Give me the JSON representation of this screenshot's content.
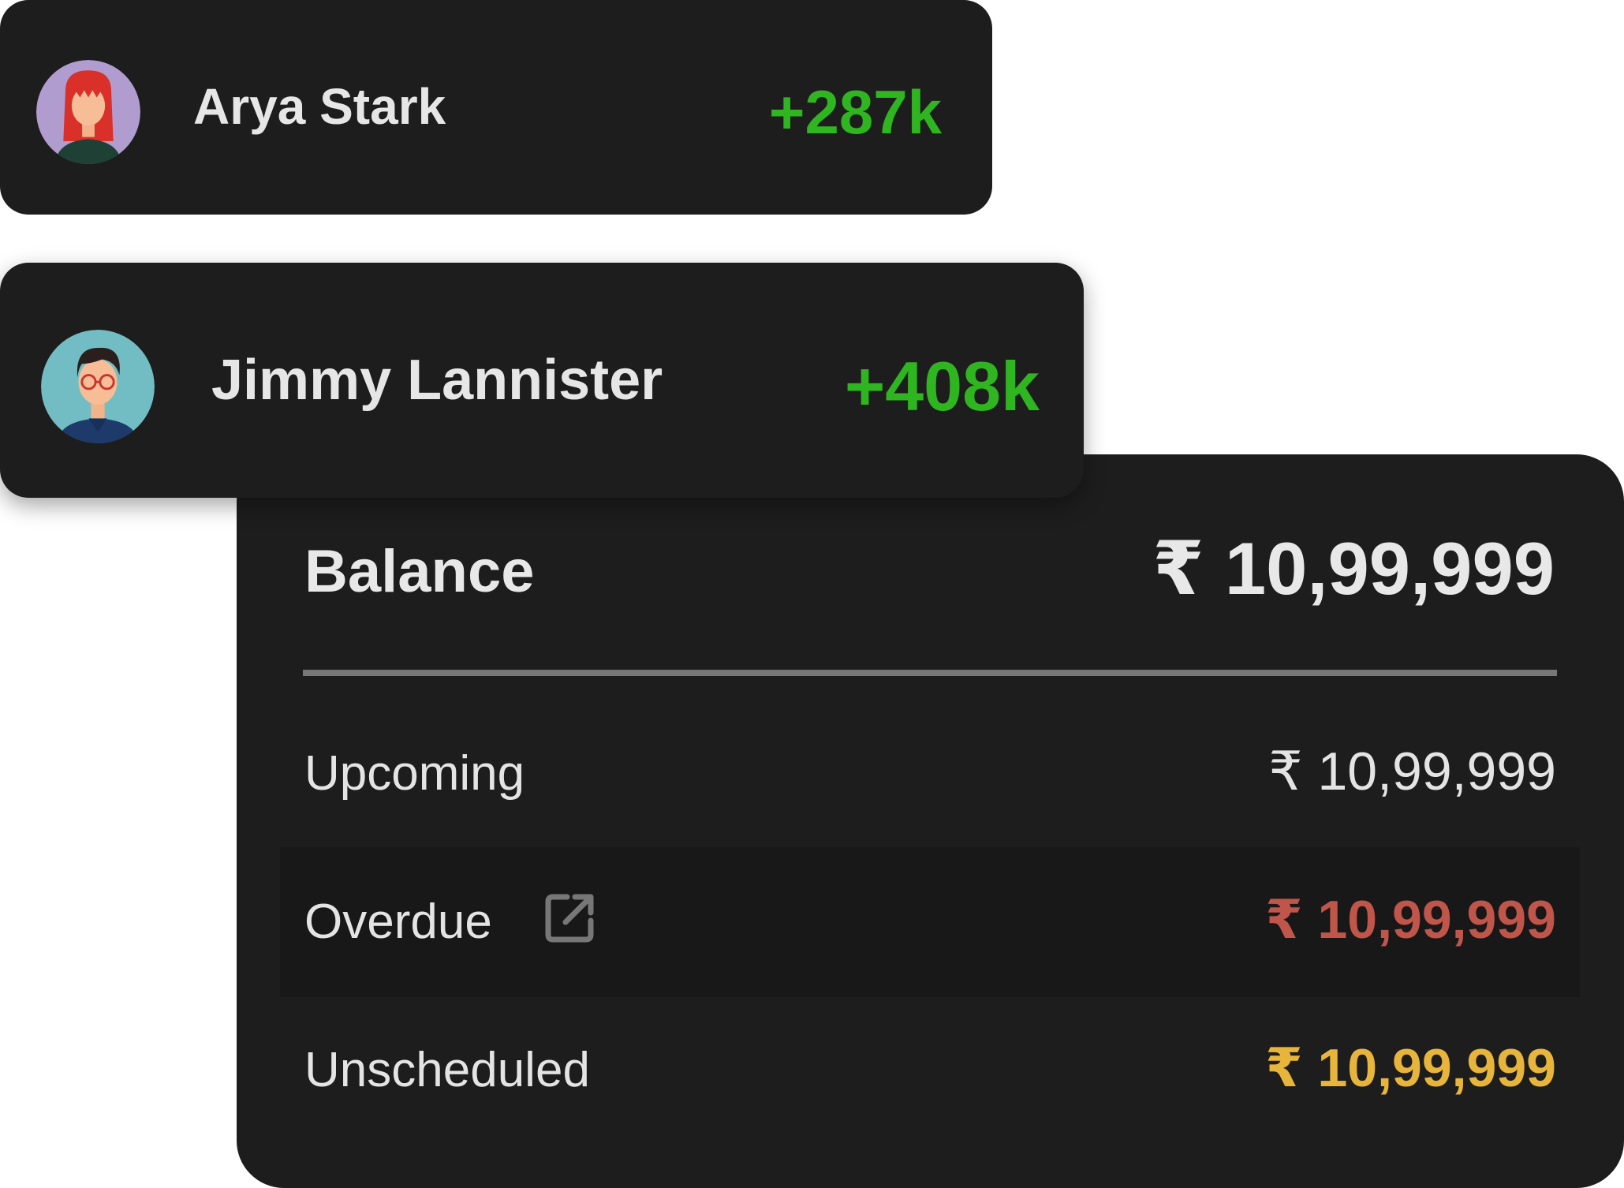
{
  "users": [
    {
      "name": "Arya Stark",
      "delta": "+287k",
      "avatar": "avatar-arya-icon"
    },
    {
      "name": "Jimmy Lannister",
      "delta": "+408k",
      "avatar": "avatar-jimmy-icon"
    }
  ],
  "balance": {
    "label": "Balance",
    "amount": "₹ 10,99,999"
  },
  "rows": {
    "upcoming": {
      "label": "Upcoming",
      "amount": "₹ 10,99,999"
    },
    "overdue": {
      "label": "Overdue",
      "amount": "₹ 10,99,999",
      "icon": "external-link-icon"
    },
    "unscheduled": {
      "label": "Unscheduled",
      "amount": "₹ 10,99,999"
    }
  },
  "colors": {
    "card_bg": "#1d1d1d",
    "positive": "#2fb51f",
    "overdue": "#c0554a",
    "unscheduled": "#e8b53c",
    "text": "#e6e6e6"
  }
}
